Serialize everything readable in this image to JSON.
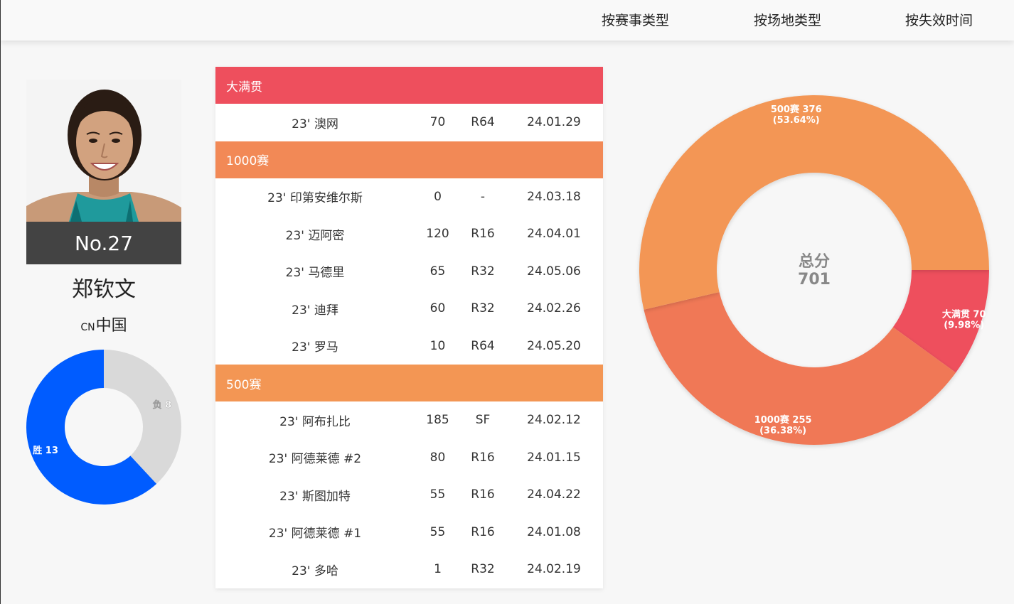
{
  "nav": {
    "items": [
      {
        "label": "按赛事类型"
      },
      {
        "label": "按场地类型"
      },
      {
        "label": "按失效时间"
      }
    ]
  },
  "player": {
    "rank": "No.27",
    "name": "郑钦文",
    "country_code": "CN",
    "country": "中国",
    "record": {
      "wins_label": "胜 13",
      "losses_label": "负 8",
      "wins": 13,
      "losses": 8,
      "win_color": "#005cff",
      "loss_color": "#d9d9d9"
    }
  },
  "table": {
    "categories": [
      {
        "name": "大满贯",
        "color": "#ee4f5d",
        "rows": [
          {
            "event": "23' 澳网",
            "points": "70",
            "round": "R64",
            "expires": "24.01.29"
          }
        ]
      },
      {
        "name": "1000赛",
        "color": "#f28956",
        "rows": [
          {
            "event": "23' 印第安维尔斯",
            "points": "0",
            "round": "-",
            "expires": "24.03.18"
          },
          {
            "event": "23' 迈阿密",
            "points": "120",
            "round": "R16",
            "expires": "24.04.01"
          },
          {
            "event": "23' 马德里",
            "points": "65",
            "round": "R32",
            "expires": "24.05.06"
          },
          {
            "event": "23' 迪拜",
            "points": "60",
            "round": "R32",
            "expires": "24.02.26"
          },
          {
            "event": "23' 罗马",
            "points": "10",
            "round": "R64",
            "expires": "24.05.20"
          }
        ]
      },
      {
        "name": "500赛",
        "color": "#f39654",
        "rows": [
          {
            "event": "23' 阿布扎比",
            "points": "185",
            "round": "SF",
            "expires": "24.02.12"
          },
          {
            "event": "23' 阿德莱德 #2",
            "points": "80",
            "round": "R16",
            "expires": "24.01.15"
          },
          {
            "event": "23' 斯图加特",
            "points": "55",
            "round": "R16",
            "expires": "24.04.22"
          },
          {
            "event": "23' 阿德莱德 #1",
            "points": "55",
            "round": "R16",
            "expires": "24.01.08"
          },
          {
            "event": "23' 多哈",
            "points": "1",
            "round": "R32",
            "expires": "24.02.19"
          }
        ]
      }
    ]
  },
  "chart_data": [
    {
      "type": "pie",
      "categories": [
        "胜",
        "负"
      ],
      "values": [
        13,
        8
      ],
      "labels": [
        "胜 13",
        "负 8"
      ],
      "colors": [
        "#005cff",
        "#d9d9d9"
      ]
    },
    {
      "type": "pie",
      "center_title": "总分",
      "center_value": "701",
      "categories": [
        "大满贯",
        "1000赛",
        "500赛"
      ],
      "values": [
        70,
        255,
        376
      ],
      "labels": [
        "大满贯 70",
        "1000赛 255",
        "500赛 376"
      ],
      "percent_labels": [
        "(9.98%)",
        "(36.38%)",
        "(53.64%)"
      ],
      "colors": [
        "#ee4f5d",
        "#f07856",
        "#f39654"
      ]
    }
  ]
}
